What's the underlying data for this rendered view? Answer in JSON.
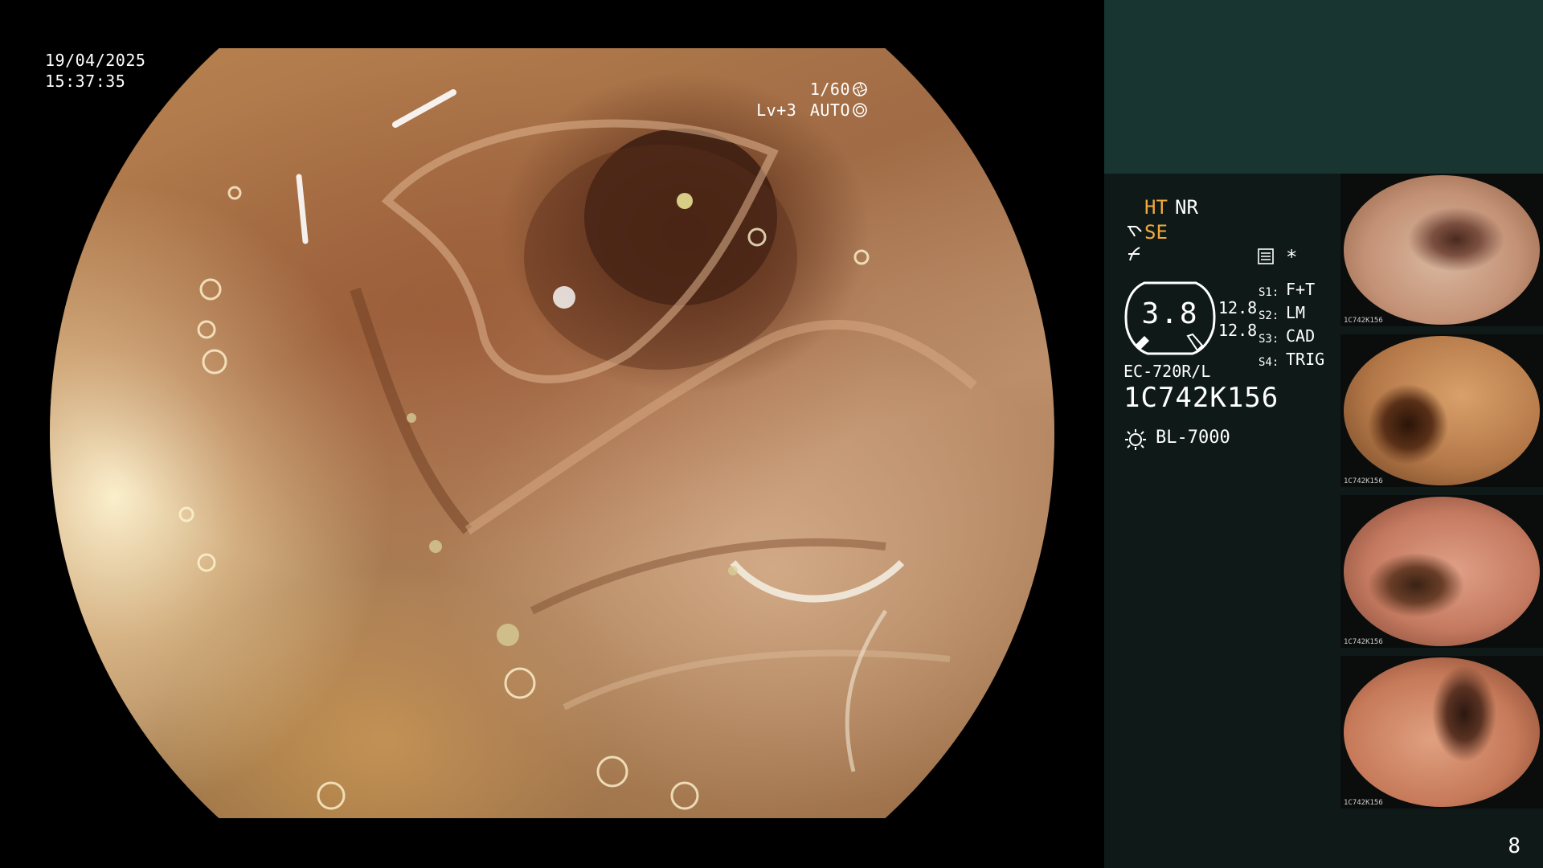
{
  "main_view": {
    "date": "19/04/2025",
    "time": "15:37:35",
    "shutter": "1/60",
    "shutter_icon": "shutter-icon",
    "level": "Lv+3",
    "exposure_mode": "AUTO",
    "exposure_icon": "auto-iris-icon"
  },
  "panel": {
    "colors": {
      "accent": "#f2a93b",
      "header": "#183532",
      "background": "#0f1a18"
    },
    "mode_ht": "HT",
    "mode_nr": "NR",
    "mode_se": "SE",
    "se_icon": "tool-icon",
    "nf_icon": "freeze-icon",
    "grid_icon": "grid-icon",
    "star": "*",
    "magnification": "3.8",
    "value_1": "12.8",
    "value_2": "12.8",
    "scope_functions": [
      {
        "key": "S1:",
        "value": "F+T"
      },
      {
        "key": "S2:",
        "value": "LM"
      },
      {
        "key": "S3:",
        "value": "CAD"
      },
      {
        "key": "S4:",
        "value": "TRIG"
      }
    ],
    "scope_model": "EC-720R/L",
    "scope_serial": "1C742K156",
    "light_icon": "light-source-icon",
    "light_source": "BL-7000",
    "thumbnail_caption": "1C742K156",
    "page_number": "8"
  }
}
